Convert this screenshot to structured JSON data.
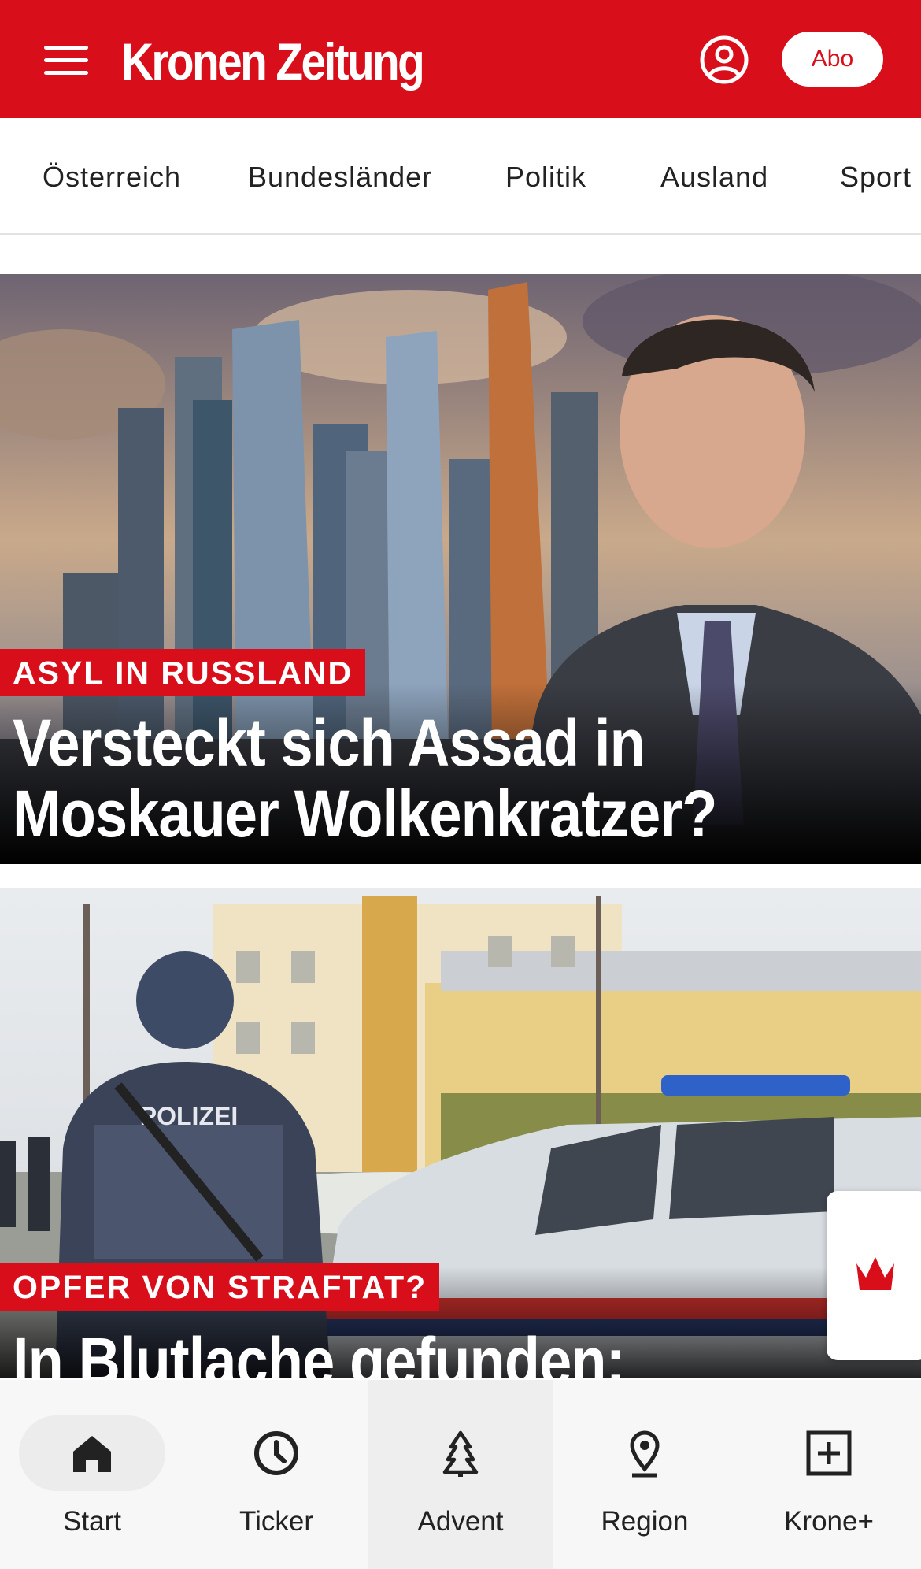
{
  "header": {
    "logo_text": "Kronen Zeitung",
    "abo_label": "Abo",
    "brand_color": "#d90e1b"
  },
  "categories": [
    {
      "label": "Österreich"
    },
    {
      "label": "Bundesländer"
    },
    {
      "label": "Politik"
    },
    {
      "label": "Ausland"
    },
    {
      "label": "Sport"
    }
  ],
  "articles": [
    {
      "kicker": "ASYL IN RUSSLAND",
      "headline_line1": "Versteckt sich Assad in",
      "headline_line2": "Moskauer Wolkenkratzer?"
    },
    {
      "kicker": "OPFER VON STRAFTAT?",
      "headline_line1": "In Blutlache gefunden:",
      "photo_text": "POLIZEI"
    }
  ],
  "bottom_nav": {
    "items": [
      {
        "label": "Start",
        "icon": "home-icon",
        "selected": true
      },
      {
        "label": "Ticker",
        "icon": "clock-icon"
      },
      {
        "label": "Advent",
        "icon": "tree-icon"
      },
      {
        "label": "Region",
        "icon": "location-pin-icon"
      },
      {
        "label": "Krone+",
        "icon": "plus-box-icon"
      }
    ]
  }
}
